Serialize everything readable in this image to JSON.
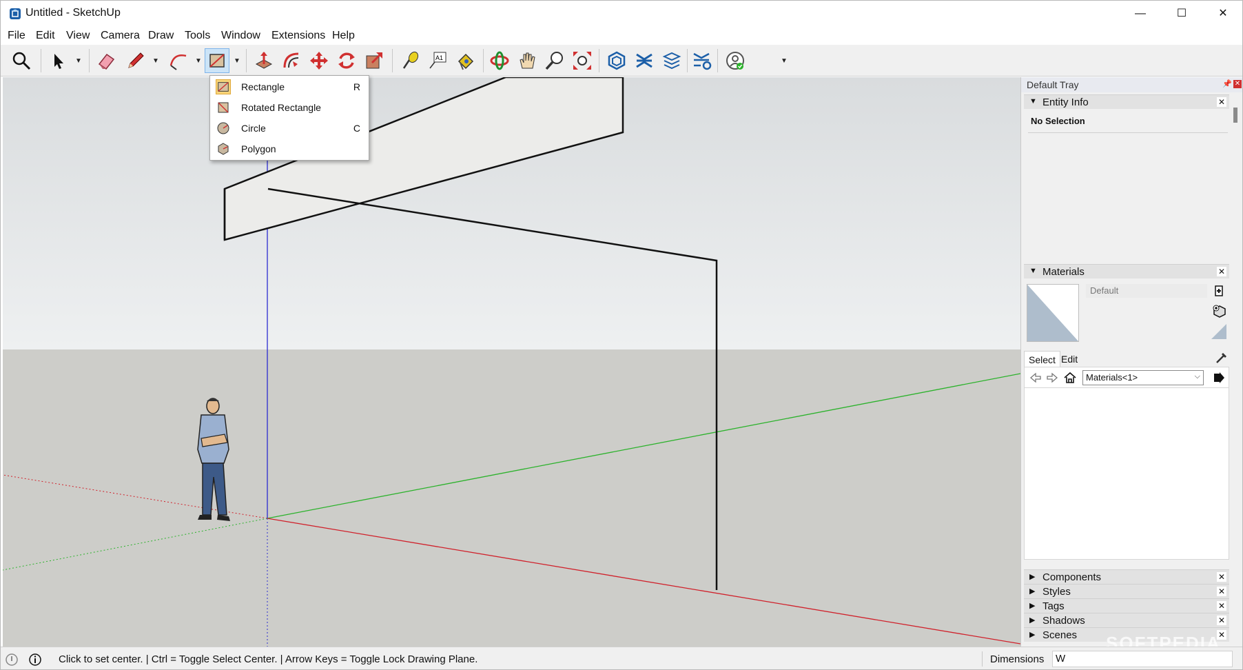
{
  "window": {
    "title": "Untitled - SketchUp",
    "controls": {
      "minimize": "—",
      "maximize": "☐",
      "close": "✕"
    }
  },
  "menu": [
    "File",
    "Edit",
    "View",
    "Camera",
    "Draw",
    "Tools",
    "Window",
    "Extensions",
    "Help"
  ],
  "toolbar": {
    "tools": [
      "search-icon",
      "select-icon",
      "eraser-icon",
      "pencil-icon",
      "arc-icon",
      "rectangle-icon",
      "push-pull-icon",
      "offset-icon",
      "move-icon",
      "rotate-icon",
      "scale-icon",
      "tape-measure-icon",
      "text-icon",
      "paint-bucket-icon",
      "orbit-icon",
      "pan-icon",
      "zoom-icon",
      "zoom-extents-icon",
      "warehouse-icon",
      "extension-warehouse-icon",
      "layout-icon",
      "extension-manager-icon",
      "account-icon"
    ],
    "active_tool": "rectangle-icon"
  },
  "shape_menu": {
    "items": [
      {
        "label": "Rectangle",
        "shortcut": "R",
        "icon": "rectangle-icon"
      },
      {
        "label": "Rotated Rectangle",
        "shortcut": "",
        "icon": "rotated-rectangle-icon"
      },
      {
        "label": "Circle",
        "shortcut": "C",
        "icon": "circle-icon"
      },
      {
        "label": "Polygon",
        "shortcut": "",
        "icon": "polygon-icon"
      }
    ]
  },
  "tray": {
    "title": "Default Tray",
    "entity_info": {
      "label": "Entity Info",
      "selection": "No Selection"
    },
    "materials": {
      "label": "Materials",
      "current_material": "Default",
      "tabs": [
        "Select",
        "Edit"
      ],
      "collection": "Materials<1>"
    },
    "collapsed_panels": [
      "Components",
      "Styles",
      "Tags",
      "Shadows",
      "Scenes"
    ]
  },
  "status": {
    "message": "Click to set center. | Ctrl = Toggle Select Center. | Arrow Keys = Toggle Lock Drawing Plane.",
    "dimensions_label": "Dimensions",
    "dimensions_value": "W"
  },
  "watermark": "SOFTPEDIA",
  "colors": {
    "sky": "#e8eaec",
    "ground": "#cdcdc9",
    "axis_red": "#d0202a",
    "axis_green": "#2bb22b",
    "axis_blue": "#2a2ad0",
    "toolbar_bg": "#f0f0f0",
    "active_tool": "#cce4f7"
  }
}
